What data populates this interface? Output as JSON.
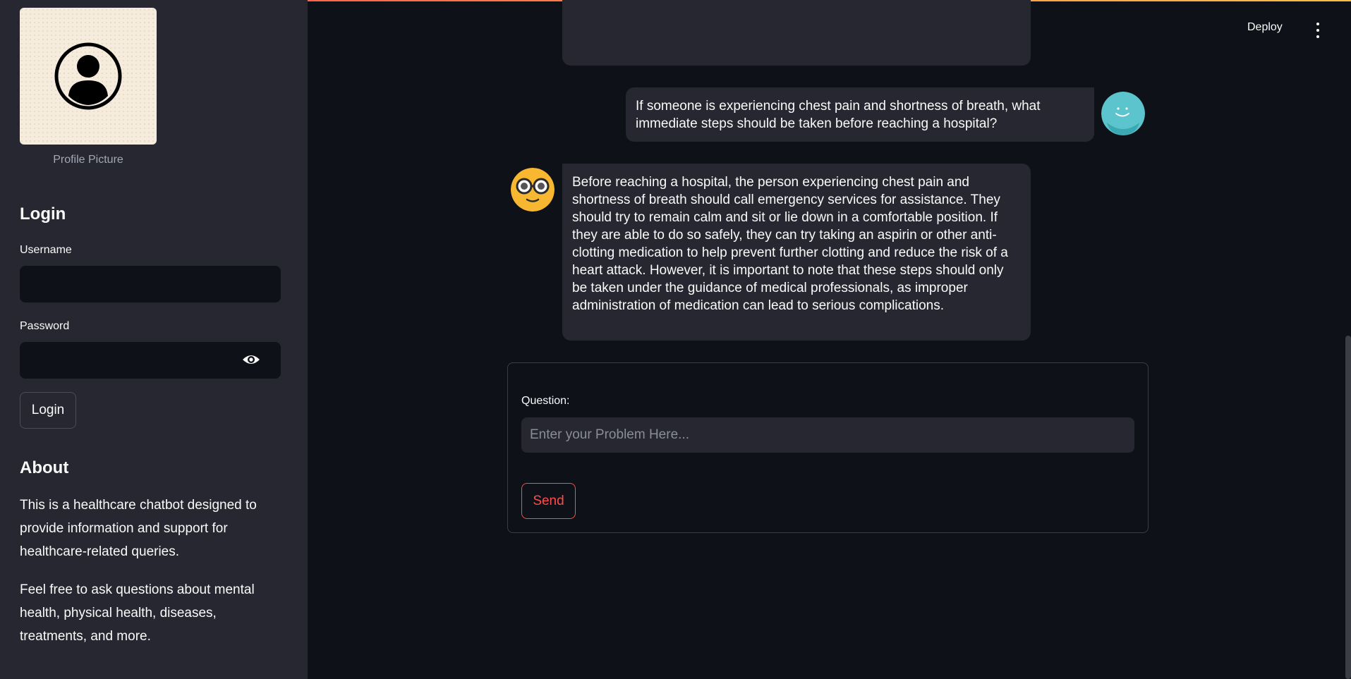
{
  "header": {
    "deploy_label": "Deploy",
    "menu_icon": "kebab-menu-icon"
  },
  "sidebar": {
    "profile_caption": "Profile Picture",
    "profile_icon": "user-avatar-icon",
    "login": {
      "heading": "Login",
      "username_label": "Username",
      "username_value": "",
      "password_label": "Password",
      "password_value": "",
      "eye_icon": "eye-icon",
      "button_label": "Login"
    },
    "about": {
      "heading": "About",
      "p1": "This is a healthcare chatbot designed to provide information and support for healthcare-related queries.",
      "p2": "Feel free to ask questions about mental health, physical health, diseases, treatments, and more."
    }
  },
  "chat": {
    "messages": [
      {
        "role": "user",
        "text": "If someone is experiencing chest pain and shortness of breath, what immediate steps should be taken before reaching a hospital?"
      },
      {
        "role": "assistant",
        "text": "Before reaching a hospital, the person experiencing chest pain and shortness of breath should call emergency services for assistance. They should try to remain calm and sit or lie down in a comfortable position. If they are able to do so safely, they can try taking an aspirin or other anti-clotting medication to help prevent further clotting and reduce the risk of a heart attack. However, it is important to note that these steps should only be taken under the guidance of medical professionals, as improper administration of medication can lead to serious complications."
      }
    ]
  },
  "form": {
    "question_label": "Question:",
    "question_placeholder": "Enter your Problem Here...",
    "question_value": "",
    "send_label": "Send"
  },
  "colors": {
    "accent": "#ff4b4b",
    "background": "#0e1117",
    "sidebar": "#262730"
  }
}
